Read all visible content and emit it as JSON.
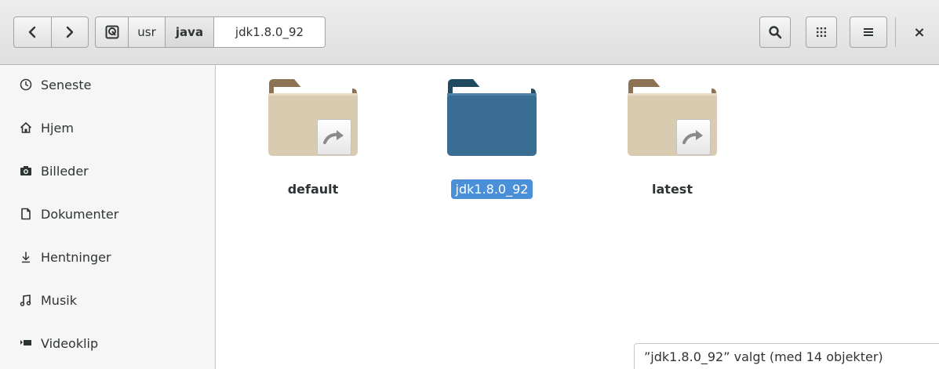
{
  "header": {
    "back_icon": "chevron-left-icon",
    "forward_icon": "chevron-right-icon",
    "breadcrumb": {
      "root_icon": "filesystem-root-icon",
      "items": [
        "usr",
        "java",
        "jdk1.8.0_92"
      ]
    },
    "search_icon": "search-icon",
    "view_icon": "icon-grid-icon",
    "menu_icon": "hamburger-menu-icon",
    "close_label": "×"
  },
  "sidebar": {
    "items": [
      {
        "label": "Seneste",
        "icon": "clock-icon"
      },
      {
        "label": "Hjem",
        "icon": "home-icon"
      },
      {
        "label": "Billeder",
        "icon": "camera-icon"
      },
      {
        "label": "Dokumenter",
        "icon": "document-icon"
      },
      {
        "label": "Hentninger",
        "icon": "download-icon"
      },
      {
        "label": "Musik",
        "icon": "music-icon"
      },
      {
        "label": "Videoklip",
        "icon": "video-icon"
      }
    ]
  },
  "main": {
    "items": [
      {
        "name": "default",
        "type": "symlink-folder",
        "selected": false
      },
      {
        "name": "jdk1.8.0_92",
        "type": "folder",
        "selected": true
      },
      {
        "name": "latest",
        "type": "symlink-folder",
        "selected": false
      }
    ]
  },
  "status": {
    "text": "”jdk1.8.0_92” valgt  (med 14 objekter)"
  },
  "colors": {
    "selection": "#4a90d9",
    "folder_tan": "#d9cbb0",
    "folder_tan_back": "#8b7353",
    "folder_blue": "#3a6d94",
    "folder_blue_back": "#1f4a60"
  }
}
